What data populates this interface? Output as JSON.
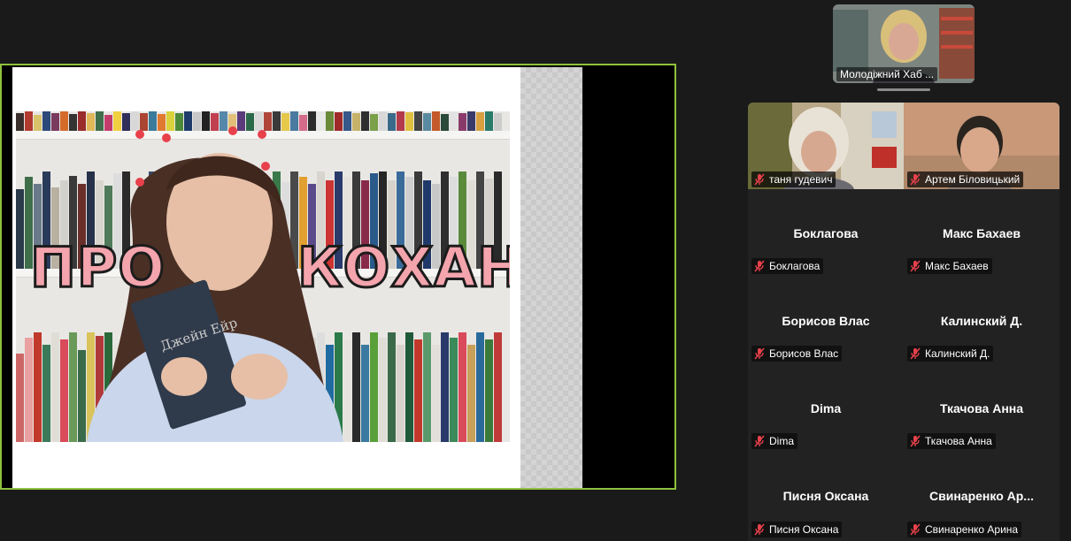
{
  "shared_screen": {
    "slide_title_left": "ПРО",
    "slide_title_right": "КОХАННЯ",
    "book_title": "Джейн Ейр"
  },
  "top_tile": {
    "name": "Молодіжний Хаб ..."
  },
  "video_tiles": [
    {
      "name": "таня гудевич",
      "muted": true
    },
    {
      "name": "Артем Біловицький",
      "muted": true
    }
  ],
  "participants": [
    {
      "display": "Боклагова",
      "tag": "Боклагова",
      "muted": true
    },
    {
      "display": "Макс Бахаев",
      "tag": "Макс Бахаев",
      "muted": true
    },
    {
      "display": "Борисов Влас",
      "tag": "Борисов Влас",
      "muted": true
    },
    {
      "display": "Калинский Д.",
      "tag": "Калинский Д.",
      "muted": true
    },
    {
      "display": "Dima",
      "tag": "Dima",
      "muted": true
    },
    {
      "display": "Ткачова Анна",
      "tag": "Ткачова Анна",
      "muted": true
    },
    {
      "display": "Писня Оксана",
      "tag": "Писня Оксана",
      "muted": true
    },
    {
      "display": "Свинаренко  Ар...",
      "tag": "Свинаренко Арина",
      "muted": true
    }
  ],
  "colors": {
    "active_speaker_border": "#8fc13d",
    "mute_red": "#e8414b",
    "background": "#1a1a1a"
  }
}
